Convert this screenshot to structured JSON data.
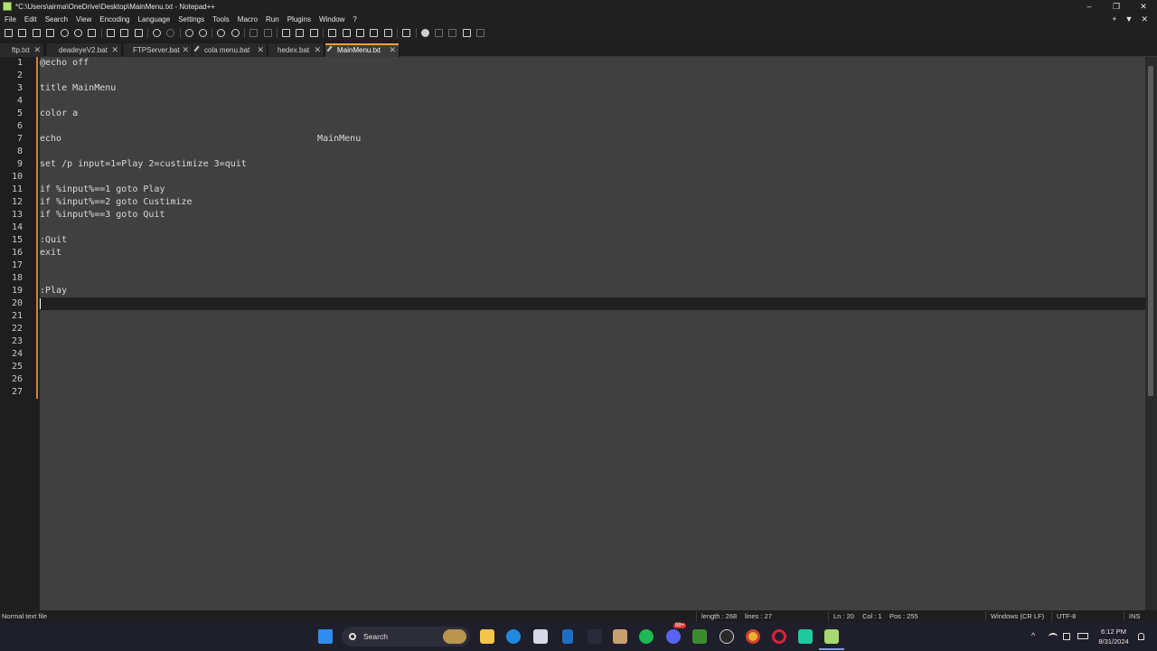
{
  "window": {
    "title": "*C:\\Users\\airma\\OneDrive\\Desktop\\MainMenu.txt - Notepad++",
    "minimize": "–",
    "maximize": "❐",
    "close": "✕"
  },
  "menu": {
    "items": [
      "File",
      "Edit",
      "Search",
      "View",
      "Encoding",
      "Language",
      "Settings",
      "Tools",
      "Macro",
      "Run",
      "Plugins",
      "Window",
      "?"
    ],
    "right_controls": [
      "+",
      "▼",
      "✕"
    ]
  },
  "tabs": [
    {
      "label": "ftp.txt",
      "modified": false,
      "active": false
    },
    {
      "label": "deadeyeV2.bat",
      "modified": false,
      "active": false
    },
    {
      "label": "FTPServer.bat",
      "modified": false,
      "active": false
    },
    {
      "label": "cola menu.bat",
      "modified": true,
      "active": false
    },
    {
      "label": "hedex.bat",
      "modified": false,
      "active": false
    },
    {
      "label": "MainMenu.txt",
      "modified": true,
      "active": true
    }
  ],
  "tab_close_glyph": "✕",
  "editor": {
    "lines": [
      {
        "n": "1",
        "text": "@echo off"
      },
      {
        "n": "2",
        "text": ""
      },
      {
        "n": "3",
        "text": "title MainMenu"
      },
      {
        "n": "4",
        "text": ""
      },
      {
        "n": "5",
        "text": "color a"
      },
      {
        "n": "6",
        "text": ""
      },
      {
        "n": "7",
        "text": "echo                                               MainMenu"
      },
      {
        "n": "8",
        "text": ""
      },
      {
        "n": "9",
        "text": "set /p input=1=Play 2=custimize 3=quit"
      },
      {
        "n": "10",
        "text": ""
      },
      {
        "n": "11",
        "text": "if %input%==1 goto Play"
      },
      {
        "n": "12",
        "text": "if %input%==2 goto Custimize"
      },
      {
        "n": "13",
        "text": "if %input%==3 goto Quit"
      },
      {
        "n": "14",
        "text": ""
      },
      {
        "n": "15",
        "text": ":Quit"
      },
      {
        "n": "16",
        "text": "exit"
      },
      {
        "n": "17",
        "text": ""
      },
      {
        "n": "18",
        "text": ""
      },
      {
        "n": "19",
        "text": ":Play"
      },
      {
        "n": "20",
        "text": ""
      },
      {
        "n": "21",
        "text": ""
      },
      {
        "n": "22",
        "text": ""
      },
      {
        "n": "23",
        "text": ""
      },
      {
        "n": "24",
        "text": ""
      },
      {
        "n": "25",
        "text": ""
      },
      {
        "n": "26",
        "text": ""
      },
      {
        "n": "27",
        "text": ""
      }
    ],
    "current_line": 20
  },
  "status": {
    "file_type": "Normal text file",
    "length": "length : 268",
    "lines": "lines : 27",
    "ln": "Ln : 20",
    "col": "Col : 1",
    "pos": "Pos : 255",
    "eol": "Windows (CR LF)",
    "encoding": "UTF-8",
    "ins": "INS"
  },
  "taskbar": {
    "search_label": "Search",
    "time": "6:12 PM",
    "date": "8/31/2024",
    "discord_badge": "99+"
  },
  "colors": {
    "active_tab_accent": "#f0a030",
    "change_marker": "#e07a3a",
    "editor_bg": "#404040",
    "current_line_bg": "#202020"
  }
}
